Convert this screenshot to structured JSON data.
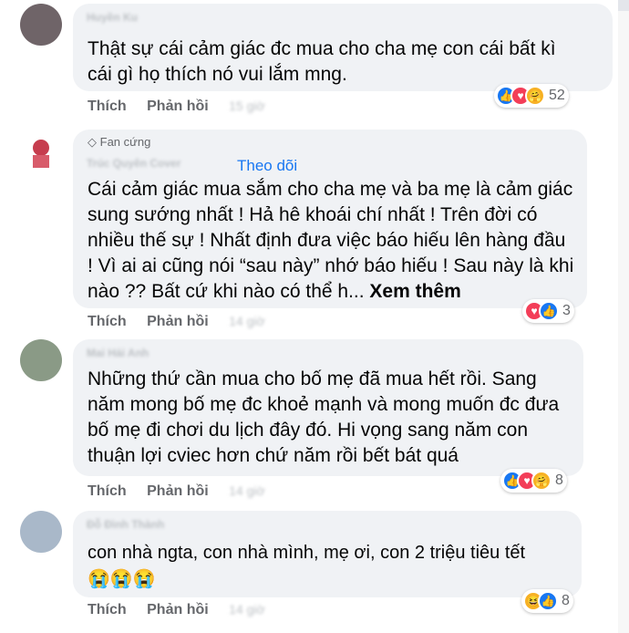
{
  "comments": [
    {
      "name": "Huyền Ku",
      "text": "Thật sự cái cảm giác đc mua cho cha mẹ con cái bất kì\ncái gì họ thích nó vui lắm mng.",
      "like_label": "Thích",
      "reply_label": "Phản hồi",
      "time": "15 giờ",
      "reaction_count": "52",
      "reactions": [
        "like-icon",
        "love-icon",
        "care-icon"
      ],
      "avatar_color": "#6f6468"
    },
    {
      "badge": "Fan cứng",
      "name": "Trúc Quyên Cover",
      "follow_label": "Theo dõi",
      "text": "Cái cảm giác mua sắm cho cha mẹ và ba mẹ là cảm giác\nsung sướng nhất ! Hả hê khoái chí nhất ! Trên đời có\nnhiều thế sự ! Nhất định đưa việc báo hiếu lên hàng đầu\n! Vì ai ai cũng nói “sau này” nhớ báo hiếu ! Sau này là khi\nnào ?? Bất cứ khi nào có thể h... ",
      "more_label": "Xem thêm",
      "like_label": "Thích",
      "reply_label": "Phản hồi",
      "time": "14 giờ",
      "reaction_count": "3",
      "reactions": [
        "love-icon",
        "like-icon"
      ],
      "avatar_color": "#c63d4e"
    },
    {
      "name": "Mai Hải Anh",
      "text": "Những thứ cần mua cho bố mẹ đã mua hết rồi. Sang\nnăm mong bố mẹ đc khoẻ mạnh và mong muốn đc đưa\nbố mẹ đi chơi du lịch đây đó. Hi vọng sang năm con\nthuận lợi cviec hơn chứ năm rồi bết bát quá",
      "like_label": "Thích",
      "reply_label": "Phản hồi",
      "time": "14 giờ",
      "reaction_count": "8",
      "reactions": [
        "like-icon",
        "love-icon",
        "care-icon"
      ],
      "avatar_color": "#8a9a86"
    },
    {
      "name": "Đỗ Đình Thành",
      "text": "con nhà ngta, con nhà mình, mẹ ơi, con 2 triệu tiêu tết",
      "emoji": "😭😭😭",
      "like_label": "Thích",
      "reply_label": "Phản hồi",
      "time": "14 giờ",
      "reaction_count": "8",
      "reactions": [
        "haha-icon",
        "like-icon"
      ],
      "avatar_color": "#a9b8c9"
    }
  ]
}
